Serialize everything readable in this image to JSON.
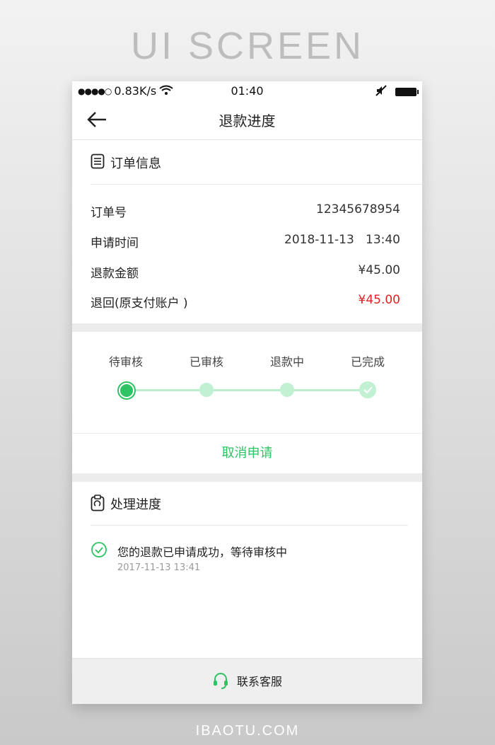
{
  "banner": {
    "title": "UI SCREEN",
    "footer": "IBAOTU.COM"
  },
  "statusbar": {
    "signal": "●●●●○",
    "speed": "0.83K/s",
    "time": "01:40",
    "mute_icon": "mute-icon",
    "battery_icon": "battery-icon"
  },
  "navbar": {
    "title": "退款进度",
    "back_icon": "back-arrow-icon"
  },
  "order": {
    "section_title": "订单信息",
    "rows": [
      {
        "label": "订单号",
        "value": "12345678954"
      },
      {
        "label": "申请时间",
        "value": "2018-11-13   13:40"
      },
      {
        "label": "退款金额",
        "value": "¥45.00"
      },
      {
        "label": "退回(原支付账户 )",
        "value": "¥45.00"
      }
    ]
  },
  "steps": {
    "labels": [
      "待审核",
      "已审核",
      "退款中",
      "已完成"
    ],
    "current_step": 1,
    "colors": {
      "active": "#2ec363",
      "inactive": "#c1f0d2",
      "line": "#b9efcc"
    }
  },
  "cancel_label": "取消申请",
  "progress": {
    "section_title": "处理进度",
    "items": [
      {
        "message": "您的退款已申请成功，等待审核中",
        "time": "2017-11-13 13:41"
      }
    ]
  },
  "contact": {
    "label": "联系客服",
    "icon": "headset-icon"
  },
  "colors": {
    "accent": "#2ec363",
    "price_red": "#e02020"
  }
}
